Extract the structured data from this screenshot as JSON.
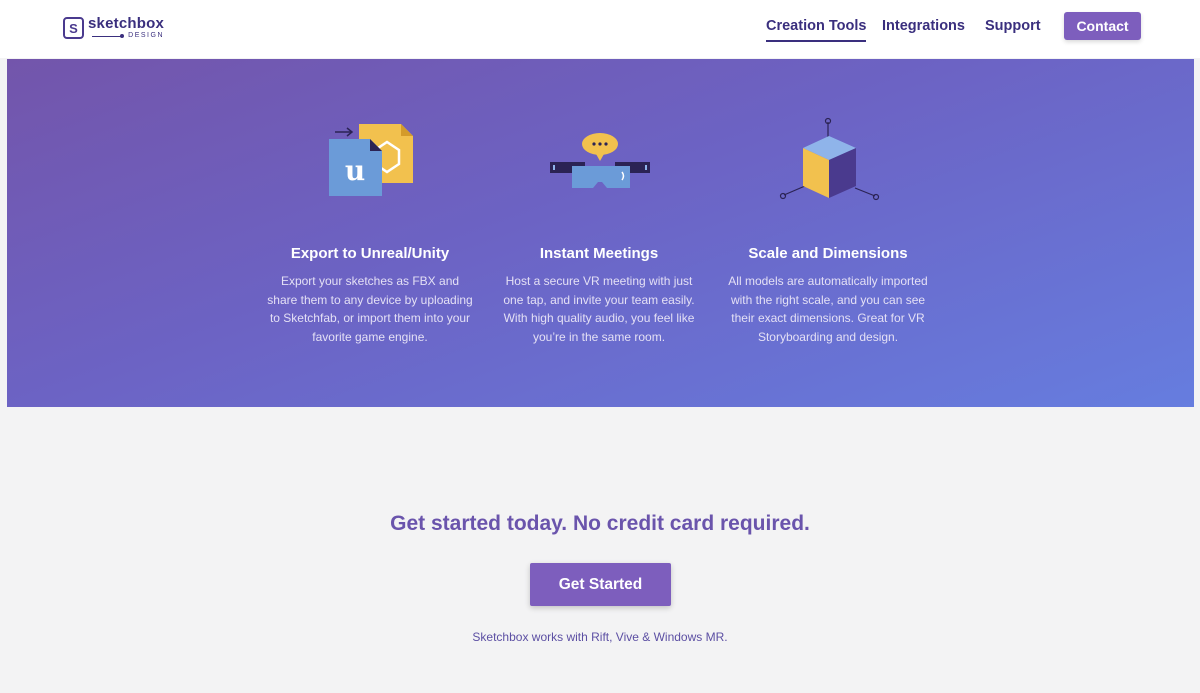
{
  "brand": {
    "logo_letter": "S",
    "name": "sketchbox",
    "subtitle": "DESIGN"
  },
  "nav": {
    "items": [
      {
        "label": "Creation Tools",
        "active": true
      },
      {
        "label": "Integrations",
        "active": false
      },
      {
        "label": "Support",
        "active": false
      }
    ],
    "contact_label": "Contact"
  },
  "features": [
    {
      "icon": "unreal-unity-export-icon",
      "title": "Export to Unreal/Unity",
      "description": "Export your sketches as FBX and share them to any device by uploading to Sketchfab, or import them into your favorite game engine."
    },
    {
      "icon": "vr-meeting-icon",
      "title": "Instant Meetings",
      "description": "Host a secure VR meeting with just one tap, and invite your team easily. With high quality audio, you feel like you’re in the same room."
    },
    {
      "icon": "scale-cube-icon",
      "title": "Scale and Dimensions",
      "description": "All models are automatically imported with the right scale, and you can see their exact dimensions. Great for VR Storyboarding and design."
    }
  ],
  "cta": {
    "title": "Get started today. No credit card required.",
    "button_label": "Get Started",
    "note": "Sketchbox works with Rift, Vive & Windows MR."
  },
  "colors": {
    "primary": "#7d5ebd",
    "brand_dark": "#3a2f7e",
    "hero_start": "#7355ab",
    "hero_end": "#667ddf",
    "background": "#f3f3f4"
  }
}
